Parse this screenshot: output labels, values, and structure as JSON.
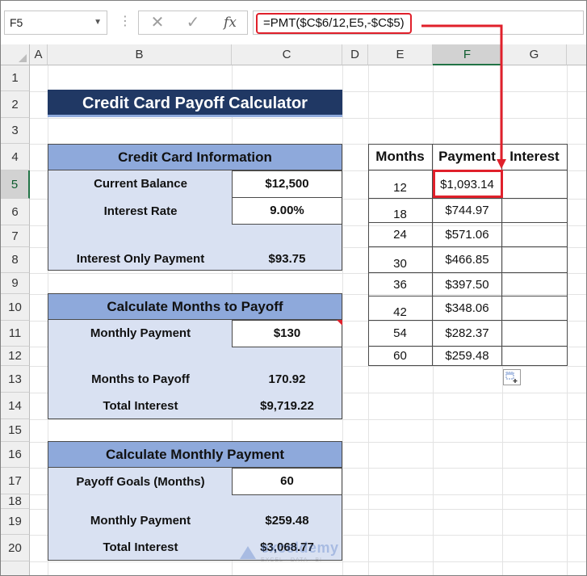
{
  "formula_bar": {
    "name_box": "F5",
    "cancel_glyph": "✕",
    "enter_glyph": "✓",
    "fx_label": "fx",
    "formula": "=PMT($C$6/12,E5,-$C$5)"
  },
  "columns": [
    "A",
    "B",
    "C",
    "D",
    "E",
    "F",
    "G"
  ],
  "selected_column": "F",
  "rows": [
    "1",
    "2",
    "3",
    "4",
    "5",
    "6",
    "7",
    "8",
    "9",
    "10",
    "11",
    "12",
    "13",
    "14",
    "15",
    "16",
    "17",
    "18",
    "19",
    "20"
  ],
  "selected_row": "5",
  "title": "Credit Card Payoff Calculator",
  "info_panel": {
    "header": "Credit Card Information",
    "current_balance_label": "Current Balance",
    "current_balance": "$12,500",
    "interest_rate_label": "Interest Rate",
    "interest_rate": "9.00%",
    "interest_only_label": "Interest Only Payment",
    "interest_only": "$93.75"
  },
  "months_panel": {
    "header": "Calculate Months to Payoff",
    "monthly_payment_label": "Monthly Payment",
    "monthly_payment": "$130",
    "months_label": "Months to Payoff",
    "months": "170.92",
    "total_interest_label": "Total Interest",
    "total_interest": "$9,719.22"
  },
  "payment_panel": {
    "header": "Calculate Monthly Payment",
    "goal_label": "Payoff Goals (Months)",
    "goal": "60",
    "monthly_payment_label": "Monthly Payment",
    "monthly_payment": "$259.48",
    "total_interest_label": "Total Interest",
    "total_interest": "$3,068.77"
  },
  "payment_table": {
    "headers": [
      "Months",
      "Payment",
      "Interest"
    ],
    "rows": [
      {
        "months": "12",
        "payment": "$1,093.14",
        "interest": ""
      },
      {
        "months": "18",
        "payment": "$744.97",
        "interest": ""
      },
      {
        "months": "24",
        "payment": "$571.06",
        "interest": ""
      },
      {
        "months": "30",
        "payment": "$466.85",
        "interest": ""
      },
      {
        "months": "36",
        "payment": "$397.50",
        "interest": ""
      },
      {
        "months": "42",
        "payment": "$348.06",
        "interest": ""
      },
      {
        "months": "54",
        "payment": "$282.37",
        "interest": ""
      },
      {
        "months": "60",
        "payment": "$259.48",
        "interest": ""
      }
    ]
  },
  "watermark": {
    "name": "exceldemy",
    "tagline": "EXCEL · DATA · BI"
  },
  "colors": {
    "title_bg": "#203864",
    "panel_header": "#8ea9db",
    "panel_body": "#d9e1f2",
    "highlight_red": "#e0202b",
    "excel_green": "#217346"
  },
  "icons": {
    "name_box_dropdown": "chevron-down-icon",
    "quick_analysis": "quick-analysis-icon"
  }
}
